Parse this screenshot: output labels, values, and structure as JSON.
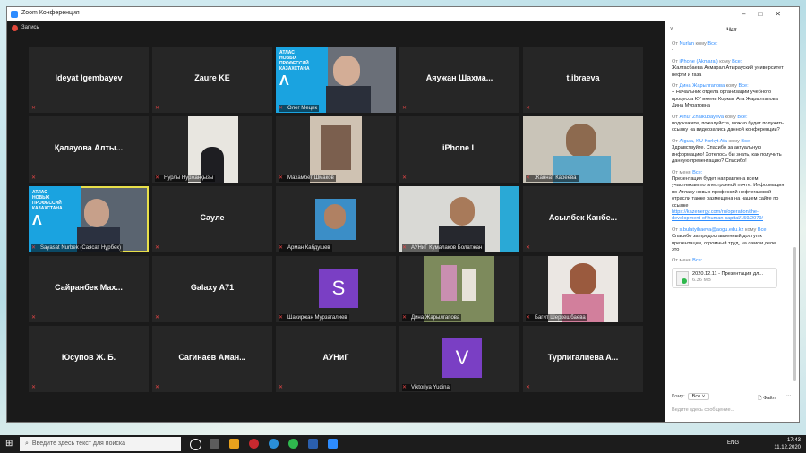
{
  "window": {
    "app_title": "Zoom Конференция",
    "recording_label": "Запись"
  },
  "tiles": [
    {
      "name": "Ideyat Igembayev"
    },
    {
      "name": "Zaure KE"
    },
    {
      "caption": "Олег Мецик",
      "atlas": [
        "АТЛАС",
        "НОВЫХ",
        "ПРОФЕССИЙ",
        "КАЗАХСТАНА"
      ]
    },
    {
      "name": "Аяужан Шахма..."
    },
    {
      "name": "t.ibraeva"
    },
    {
      "name": "Қалауова Алты..."
    },
    {
      "caption": "Нурлы Нуржанқызы"
    },
    {
      "caption": "Махамбет Шмаков"
    },
    {
      "name": "iPhone L"
    },
    {
      "caption": "Жаннат Кареева"
    },
    {
      "caption": "Sayasat Nurbek (Саясат Нұрбек)",
      "atlas": [
        "АТЛАС",
        "НОВЫХ",
        "ПРОФЕССИЙ",
        "КАЗАХСТАНА"
      ]
    },
    {
      "name": "Сауле"
    },
    {
      "caption": "Арман Кабдушев"
    },
    {
      "caption": "АУНиГ Кумалаков Болатжан"
    },
    {
      "name": "Асылбек Канбе..."
    },
    {
      "name": "Сайранбек Мах..."
    },
    {
      "name": "Galaxy A71"
    },
    {
      "caption": "Шакиржан Мурзагалиев",
      "avatar": "S"
    },
    {
      "caption": "Дина Жарылгапова"
    },
    {
      "caption": "Багит Шеркешбаева"
    },
    {
      "name": "Юсупов Ж. Б."
    },
    {
      "name": "Сагинаев Аман..."
    },
    {
      "name": "АУНиГ"
    },
    {
      "caption": "Viktoriya Yudina",
      "avatar": "V"
    },
    {
      "name": "Турлигалиева А..."
    }
  ],
  "chat": {
    "title": "Чат",
    "messages": [
      {
        "from": "От",
        "sender": "Nurlan",
        "to": "кому",
        "to_who": "Все:",
        "text": "-"
      },
      {
        "from": "От",
        "sender": "iPhone (Akmaral)",
        "to": "кому",
        "to_who": "Все:",
        "text": "Жалгасбаева Акмарал Атырауский университет нефти и газа"
      },
      {
        "from": "От",
        "sender": "Дина Жарылгапова",
        "to": "кому",
        "to_who": "Все:",
        "text": "+ Начальник отдела организации учебного процесса КУ имени Коркыт Ата Жарылгапова Дина Муратовна"
      },
      {
        "from": "От",
        "sender": "Ainur Zhaikubayeva",
        "to": "кому",
        "to_who": "Все:",
        "text": "подскажите, пожалуйста, можно будет получить ссылку на видеозапись данной конференции?"
      },
      {
        "from": "От",
        "sender": "Aigula, KU Korkyt Ata",
        "to": "кому",
        "to_who": "Все:",
        "text": "Здравствуйте. Спасибо за актуальную информацию! Хотелось бы знать, как получить данную презентацию? Спасибо!"
      },
      {
        "from": "От",
        "sender": "меня",
        "to": "",
        "to_who": "Все:",
        "text": "Презентация будет направлена всем участникам по электронной почте. Информация по Атласу новых профессий нефтегазовой отрасли также размещена на нашем сайте по ссылке",
        "link": "https://kazenergy.com/ru/operation/the-development-of-human-capital/159/2079/"
      },
      {
        "from": "От",
        "sender": "s.bulatyibaeva@aogu.edu.kz",
        "to": "кому",
        "to_who": "Все:",
        "text": "Спасибо за предоставленный доступ к презентации, огромный труд, на самом деле это"
      },
      {
        "from": "От",
        "sender": "меня",
        "to": "",
        "to_who": "Все:",
        "text": ""
      }
    ],
    "file": {
      "name": "2020.12.11 - Презентация дл...",
      "size": "6.36 MB"
    },
    "to_label": "Кому:",
    "to_value": "Все",
    "file_button": "Файл",
    "more_button": "···",
    "input_placeholder": "Ведите здесь сообщение..."
  },
  "taskbar": {
    "search_placeholder": "Введите здесь текст для поиска",
    "lang": "ENG",
    "time": "17:43",
    "date": "11.12.2020"
  }
}
